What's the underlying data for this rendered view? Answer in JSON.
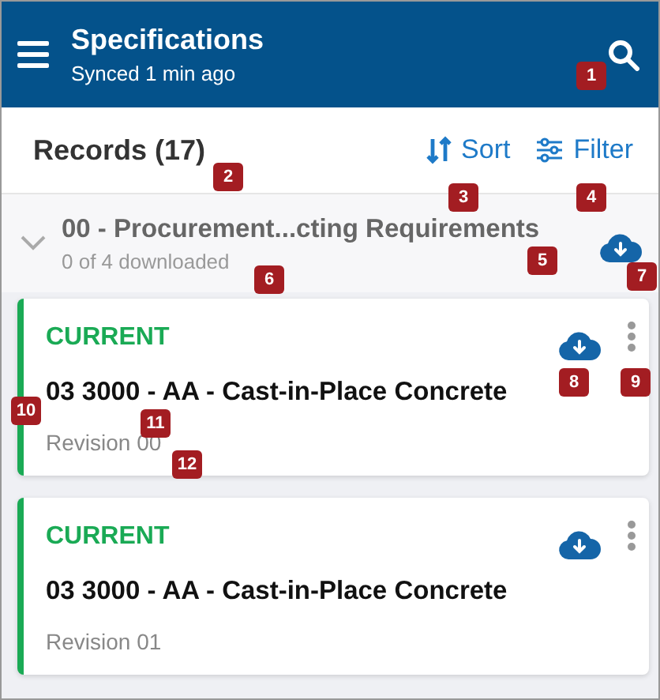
{
  "header": {
    "title": "Specifications",
    "subtitle": "Synced 1 min ago"
  },
  "toolbar": {
    "title": "Records (17)",
    "actions": [
      {
        "label": "Sort",
        "kind": "sort"
      },
      {
        "label": "Filter",
        "kind": "filter"
      }
    ]
  },
  "group": {
    "title": "00 - Procurement...cting Requirements",
    "subtitle": "0 of 4 downloaded",
    "expanded": false
  },
  "records": [
    {
      "status": "CURRENT",
      "color": "#1aaa55",
      "title": "03 3000 - AA - Cast-in-Place Concrete",
      "revision": "Revision 00"
    },
    {
      "status": "CURRENT",
      "color": "#1aaa55",
      "title": "03 3000 - AA - Cast-in-Place Concrete",
      "revision": "Revision 01"
    }
  ],
  "callouts": [
    "1",
    "2",
    "3",
    "4",
    "5",
    "6",
    "7",
    "8",
    "9",
    "10",
    "11",
    "12"
  ]
}
